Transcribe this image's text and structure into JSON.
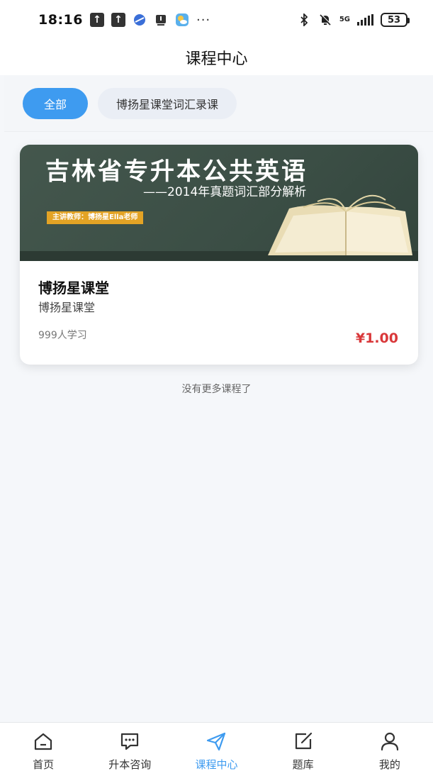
{
  "status_bar": {
    "time": "18:16",
    "network": "5G",
    "battery": "53",
    "more_indicator": "···",
    "icons": [
      "upload-icon",
      "upload-icon",
      "app-icon",
      "notification-icon",
      "weather-icon",
      "bluetooth-icon",
      "mute-icon",
      "signal-icon",
      "battery-icon"
    ]
  },
  "header": {
    "title": "课程中心"
  },
  "filters": {
    "items": [
      {
        "label": "全部",
        "active": true
      },
      {
        "label": "博扬星课堂词汇录课",
        "active": false
      }
    ]
  },
  "course": {
    "banner": {
      "title": "吉林省专升本公共英语",
      "subtitle": "——2014年真题词汇部分解析",
      "teacher": "主讲教师：博扬星Ella老师"
    },
    "name": "博扬星课堂",
    "org": "博扬星课堂",
    "learners": "999人学习",
    "price": "¥1.00"
  },
  "footer_note": "没有更多课程了",
  "tabbar": {
    "items": [
      {
        "label": "首页",
        "icon": "home-icon",
        "active": false
      },
      {
        "label": "升本咨询",
        "icon": "chat-icon",
        "active": false
      },
      {
        "label": "课程中心",
        "icon": "send-icon",
        "active": true
      },
      {
        "label": "题库",
        "icon": "edit-icon",
        "active": false
      },
      {
        "label": "我的",
        "icon": "user-icon",
        "active": false
      }
    ]
  },
  "colors": {
    "accent": "#3e9bf0",
    "price": "#d9383a",
    "banner_bg": "#44574d",
    "teacher_tag": "#e3a325"
  }
}
